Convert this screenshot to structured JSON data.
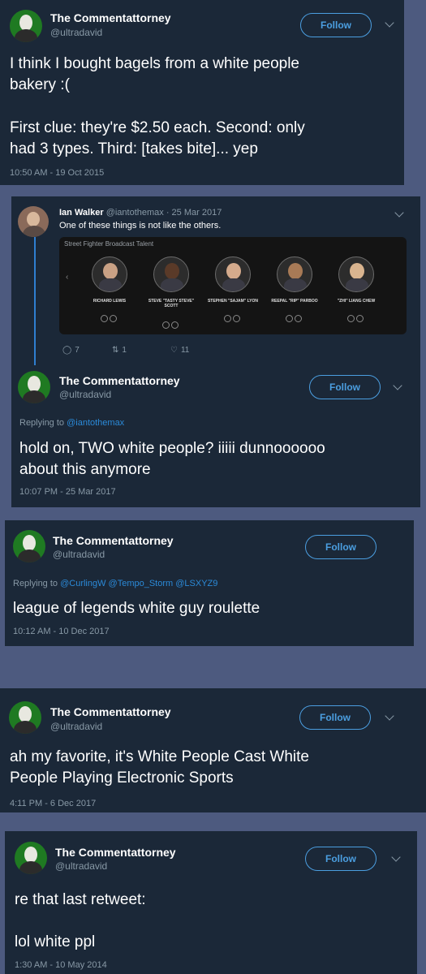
{
  "colors": {
    "page_bg": "#4d5a7f",
    "card_bg": "#1b2838",
    "accent": "#4b9ee0",
    "muted": "#8899a6",
    "avatar_green": "#1f7a22"
  },
  "tweet1": {
    "name": "The Commentattorney",
    "handle": "@ultradavid",
    "follow": "Follow",
    "text_line1": "I think I bought bagels from a white people",
    "text_line2": "bakery :(",
    "text_line3": "First clue: they're $2.50 each. Second: only",
    "text_line4": "had 3 types. Third: [takes bite]... yep",
    "time": "10:50 AM - 19 Oct 2015"
  },
  "tweet2": {
    "quoted": {
      "name": "Ian Walker",
      "handle_date": "@iantothemax · 25 Mar 2017",
      "text": "One of these things is not like the others.",
      "media_title": "Street Fighter Broadcast Talent",
      "casters": [
        {
          "name": "RICHARD LEWIS",
          "skin": "#c9a184"
        },
        {
          "name": "STEVE \"TASTY STEVE\" SCOTT",
          "skin": "#5a3a28"
        },
        {
          "name": "STEPHEN \"SAJAM\" LYON",
          "skin": "#d4aa8c"
        },
        {
          "name": "REEPAL \"RIP\" PARBOO",
          "skin": "#a87a56"
        },
        {
          "name": "\"ZHI\" LIANG CHEW",
          "skin": "#d9b48f"
        }
      ],
      "replies": "7",
      "retweets": "1",
      "likes": "11",
      "reply_icon": "reply-icon",
      "retweet_icon": "retweet-icon",
      "like_icon": "heart-icon"
    },
    "name": "The Commentattorney",
    "handle": "@ultradavid",
    "follow": "Follow",
    "replying_prefix": "Replying to ",
    "replying_to": "@iantothemax",
    "text_line1": "hold on, TWO white people? iiiii dunnoooooo",
    "text_line2": "about this anymore",
    "time": "10:07 PM - 25 Mar 2017"
  },
  "tweet3": {
    "name": "The Commentattorney",
    "handle": "@ultradavid",
    "follow": "Follow",
    "replying_prefix": "Replying to ",
    "replying_to": "@CurlingW @Tempo_Storm @LSXYZ9",
    "text_line1": "league of legends white guy roulette",
    "time": "10:12 AM - 10 Dec 2017"
  },
  "tweet4": {
    "name": "The Commentattorney",
    "handle": "@ultradavid",
    "follow": "Follow",
    "text_line1": "ah my favorite, it's White People Cast White",
    "text_line2": "People Playing Electronic Sports",
    "time": "4:11 PM - 6 Dec 2017"
  },
  "tweet5": {
    "name": "The Commentattorney",
    "handle": "@ultradavid",
    "follow": "Follow",
    "text_line1": "re that last retweet:",
    "text_line2": "lol white ppl",
    "time": "1:30 AM - 10 May 2014"
  }
}
